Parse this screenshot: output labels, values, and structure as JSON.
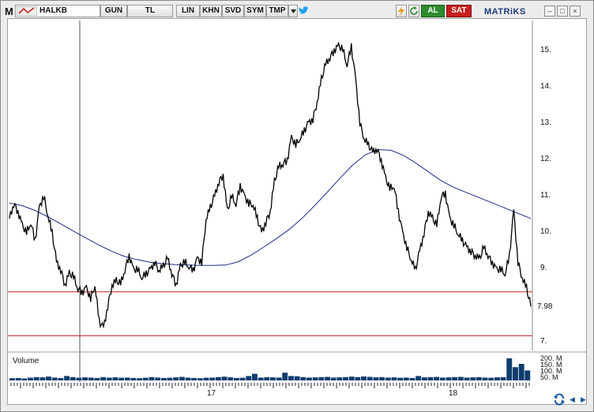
{
  "toolbar": {
    "logo": "M",
    "symbol": "HALKB",
    "buttons": [
      "GUN",
      "TL",
      "LIN",
      "KHN",
      "SVD",
      "SYM",
      "TMP"
    ],
    "buy_label": "AL",
    "sell_label": "SAT",
    "brand": "MATRiKS",
    "win_min": "–",
    "win_max": "□",
    "win_close": "×"
  },
  "colors": {
    "price": "#000000",
    "ma": "#1c2a8a",
    "level": "#c81e1e",
    "volume": "#0e3c6e",
    "buy": "#2e8b2e",
    "sell": "#c81e1e"
  },
  "price_axis": [
    "15.",
    "14.",
    "13.",
    "12.",
    "11.",
    "10.",
    "9.",
    "7."
  ],
  "current_price": "7.98",
  "volume_panel": {
    "title": "Volume",
    "labels": [
      "200. M",
      "150. M",
      "100. M",
      "50. M"
    ]
  },
  "date_labels": [
    "17",
    "18"
  ],
  "chart_data": {
    "type": "line",
    "ylim": [
      6.8,
      15.8
    ],
    "levels": [
      8.4,
      7.2
    ],
    "price": [
      10.4,
      10.8,
      10.6,
      10.2,
      10.0,
      10.3,
      9.8,
      10.7,
      11.0,
      10.5,
      10.0,
      9.2,
      9.0,
      8.6,
      8.9,
      8.8,
      8.5,
      8.4,
      8.5,
      8.2,
      8.6,
      7.6,
      7.4,
      8.0,
      8.6,
      8.7,
      8.6,
      9.0,
      9.4,
      9.0,
      9.0,
      8.8,
      8.9,
      9.0,
      9.2,
      9.0,
      9.1,
      9.3,
      8.9,
      8.6,
      9.1,
      9.2,
      9.1,
      9.0,
      9.3,
      9.2,
      10.4,
      10.7,
      11.0,
      11.4,
      11.6,
      10.6,
      11.0,
      10.8,
      11.3,
      11.0,
      10.8,
      10.8,
      10.4,
      10.0,
      10.3,
      10.6,
      11.4,
      11.8,
      11.9,
      12.0,
      12.6,
      12.4,
      12.6,
      12.8,
      13.0,
      13.1,
      13.6,
      14.2,
      14.6,
      14.8,
      15.0,
      15.1,
      15.0,
      14.6,
      15.1,
      14.2,
      13.0,
      12.6,
      12.4,
      12.2,
      12.3,
      12.0,
      11.5,
      11.2,
      11.3,
      10.6,
      10.0,
      9.6,
      9.3,
      9.0,
      9.5,
      10.0,
      10.6,
      10.4,
      10.2,
      11.0,
      11.1,
      10.4,
      10.2,
      10.0,
      9.8,
      9.6,
      9.5,
      9.4,
      9.3,
      9.6,
      9.4,
      9.2,
      9.0,
      9.0,
      8.9,
      9.4,
      10.6,
      9.2,
      8.8,
      8.5,
      8.0
    ],
    "ma": [
      10.82,
      10.75,
      10.62,
      10.45,
      10.26,
      10.06,
      9.87,
      9.68,
      9.51,
      9.37,
      9.28,
      9.21,
      9.17,
      9.14,
      9.13,
      9.12,
      9.12,
      9.13,
      9.22,
      9.4,
      9.62,
      9.85,
      10.1,
      10.4,
      10.75,
      11.12,
      11.5,
      11.86,
      12.14,
      12.28,
      12.26,
      12.12,
      11.9,
      11.66,
      11.42,
      11.24,
      11.1,
      10.96,
      10.82,
      10.68,
      10.54,
      10.4
    ],
    "volume": [
      20,
      22,
      18,
      25,
      30,
      28,
      35,
      26,
      22,
      40,
      30,
      24,
      28,
      26,
      22,
      30,
      25,
      28,
      24,
      26,
      22,
      20,
      24,
      30,
      26,
      22,
      24,
      28,
      32,
      25,
      22,
      20,
      24,
      26,
      30,
      34,
      28,
      22,
      24,
      40,
      60,
      26,
      30,
      28,
      26,
      70,
      40,
      38,
      30,
      26,
      28,
      30,
      32,
      26,
      28,
      30,
      34,
      30,
      36,
      32,
      28,
      30,
      26,
      28,
      24,
      26,
      22,
      40,
      28,
      30,
      32,
      26,
      28,
      30,
      32,
      26,
      28,
      30,
      26,
      24,
      28,
      30,
      200,
      120,
      150,
      90
    ]
  }
}
